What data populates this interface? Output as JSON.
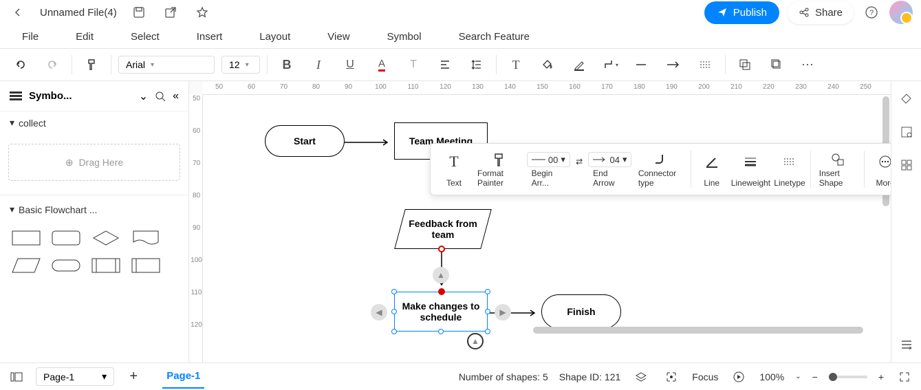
{
  "title": "Unnamed File(4)",
  "menu": {
    "file": "File",
    "edit": "Edit",
    "select": "Select",
    "insert": "Insert",
    "layout": "Layout",
    "view": "View",
    "symbol": "Symbol",
    "search": "Search Feature"
  },
  "header": {
    "publish": "Publish",
    "share": "Share"
  },
  "toolbar": {
    "font": "Arial",
    "size": "12"
  },
  "panel": {
    "title": "Symbo...",
    "collect": "collect",
    "drag": "Drag Here",
    "basic": "Basic Flowchart ..."
  },
  "ctx": {
    "text": "Text",
    "painter": "Format Painter",
    "begin_arrow": "Begin Arr...",
    "begin_val": "00",
    "end_arrow": "End Arrow",
    "end_val": "04",
    "connector": "Connector type",
    "line": "Line",
    "lineweight": "Lineweight",
    "linetype": "Linetype",
    "insert_shape": "Insert Shape",
    "more": "More"
  },
  "shapes": {
    "start": "Start",
    "meeting": "Team Meeting",
    "feedback": "Feedback from team",
    "changes": "Make changes to schedule",
    "finish": "Finish"
  },
  "status": {
    "page": "Page-1",
    "tab": "Page-1",
    "shapes": "Number of shapes: 5",
    "shape_id": "Shape ID: 121",
    "focus": "Focus",
    "zoom": "100%"
  },
  "ruler_h": [
    "50",
    "60",
    "70",
    "80",
    "90",
    "100",
    "110",
    "120",
    "130",
    "140",
    "150",
    "160",
    "170",
    "180",
    "190",
    "200",
    "210",
    "220",
    "230",
    "240",
    "250"
  ],
  "ruler_v": [
    "50",
    "60",
    "70",
    "80",
    "90",
    "100",
    "110",
    "120"
  ]
}
